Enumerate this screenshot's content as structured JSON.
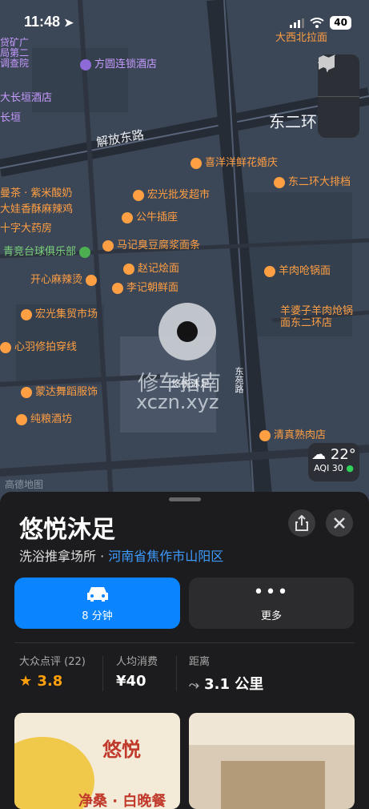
{
  "status": {
    "time": "11:48",
    "battery": "40"
  },
  "map": {
    "roads": [
      "解放东路",
      "东二环",
      "东苑路"
    ],
    "pois": [
      "贷矿广",
      "局第二",
      "调查院",
      "方圆连锁酒店",
      "大长垣酒店",
      "长垣",
      "喜洋洋鲜花婚庆",
      "东二环大排档",
      "宏光批发超市",
      "曼茶 · 紫米酸奶",
      "大娃香酥麻辣鸡",
      "公牛插座",
      "十字大药房",
      "青竞台球俱乐部",
      "马记臭豆腐浆面条",
      "赵记烩面",
      "开心麻辣烫",
      "李记朝鲜面",
      "羊肉呛锅面",
      "宏光集贸市场",
      "羊婆子羊肉炝锅面东二环店",
      "心羽修拍穿线",
      "蒙达舞蹈服饰",
      "纯粮酒坊",
      "清真熟肉店",
      "大西北拉面"
    ],
    "pin_label": "悠悦沐足",
    "watermark": [
      "修车指南",
      "xczn.xyz"
    ],
    "attribution": "高德地图"
  },
  "weather": {
    "temp": "22°",
    "aqi": "AQI 30"
  },
  "place": {
    "name": "悠悦沐足",
    "category": "洗浴推拿场所",
    "separator": " · ",
    "region": "河南省焦作市山阳区",
    "directions_label": "8 分钟",
    "more_label": "更多",
    "stats": [
      {
        "label": "大众点评 (22)",
        "value": "3.8"
      },
      {
        "label": "人均消费",
        "value": "¥40"
      },
      {
        "label": "距离",
        "value": "3.1 公里"
      }
    ],
    "photo_texts": [
      "悠悦",
      "净桑 · 白晚餐"
    ]
  },
  "colors": {
    "accent": "#0a84ff",
    "poi": "#ff9f43",
    "map_bg": "#3a4553"
  }
}
